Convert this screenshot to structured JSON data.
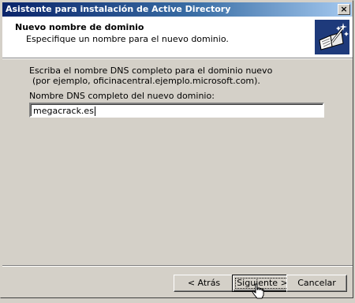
{
  "window": {
    "title": "Asistente para instalación de Active Directory",
    "close_glyph": "×"
  },
  "header": {
    "title": "Nuevo nombre de dominio",
    "subtitle": "Especifique un nombre para el nuevo dominio.",
    "icon": "active-directory-wizard-icon"
  },
  "content": {
    "instruction_line1": "Escriba el nombre DNS completo para el dominio nuevo",
    "instruction_line2": "(por ejemplo, oficinacentral.ejemplo.microsoft.com).",
    "field_label": "Nombre DNS completo del nuevo dominio:",
    "field_value": "megacrack.es"
  },
  "buttons": {
    "back": "< Atrás",
    "next": "Siguiente >",
    "cancel": "Cancelar"
  },
  "colors": {
    "title_bar_start": "#0a246a",
    "title_bar_end": "#a6caf0",
    "face": "#d4d0c8",
    "logo_bg": "#1e3a7b"
  }
}
